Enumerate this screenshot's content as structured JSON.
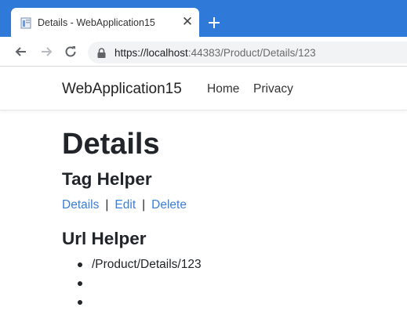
{
  "browser": {
    "tab_title": "Details - WebApplication15",
    "url_host": "https://localhost",
    "url_rest": ":44383/Product/Details/123",
    "accent": "#2f7ad9"
  },
  "navbar": {
    "brand": "WebApplication15",
    "links": [
      "Home",
      "Privacy"
    ]
  },
  "main": {
    "title": "Details",
    "tag_helper_heading": "Tag Helper",
    "tag_links": [
      "Details",
      "Edit",
      "Delete"
    ],
    "separator": "|",
    "url_helper_heading": "Url Helper",
    "url_items": [
      "/Product/Details/123",
      "",
      ""
    ],
    "link_color": "#3a7ed8"
  },
  "icons": [
    "favicon-icon",
    "close-icon",
    "plus-icon",
    "back-arrow-icon",
    "forward-arrow-icon",
    "reload-icon",
    "lock-icon"
  ]
}
